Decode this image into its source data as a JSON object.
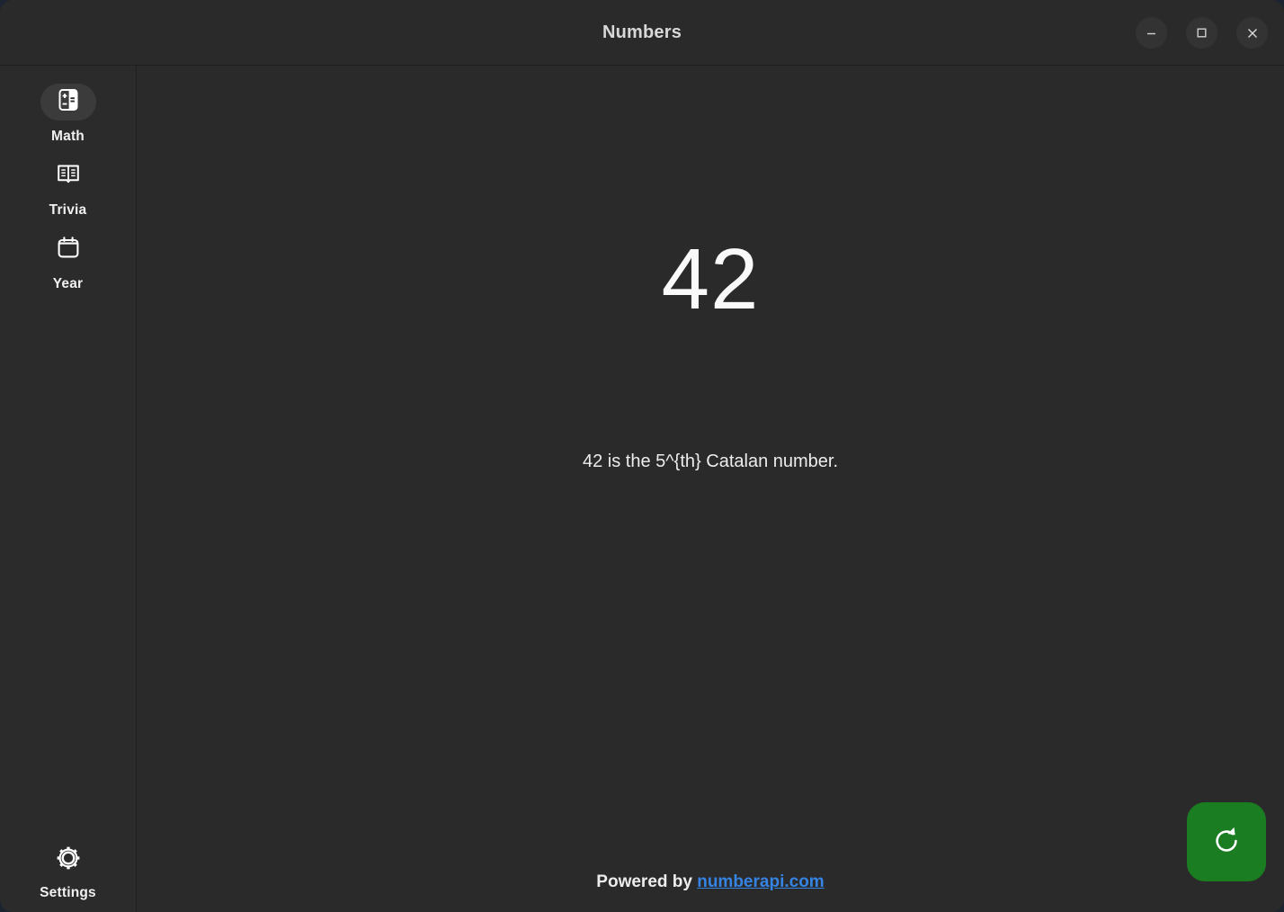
{
  "window": {
    "title": "Numbers",
    "controls": [
      {
        "name": "minimize",
        "icon": "minimize-icon"
      },
      {
        "name": "maximize",
        "icon": "maximize-icon"
      },
      {
        "name": "close",
        "icon": "close-icon"
      }
    ]
  },
  "sidebar": {
    "items": [
      {
        "label": "Math",
        "icon": "calculator-icon",
        "selected": true
      },
      {
        "label": "Trivia",
        "icon": "open-book-icon",
        "selected": false
      },
      {
        "label": "Year",
        "icon": "calendar-icon",
        "selected": false
      }
    ],
    "settings": {
      "label": "Settings",
      "icon": "gear-icon"
    }
  },
  "main": {
    "number": "42",
    "fact": "42 is the 5^{th} Catalan number."
  },
  "footer": {
    "prefix": "Powered by ",
    "link_text": "numberapi.com"
  },
  "actions": {
    "refresh": {
      "icon": "refresh-icon",
      "label": ""
    }
  },
  "colors": {
    "window_bg": "#2a2a2a",
    "sidebar_bg": "#2b2b2b",
    "selected_pill": "#3b3b3b",
    "accent_link": "#3584e4",
    "refresh_green": "#1a7d21",
    "text_primary": "#ededed",
    "desktop_bg": "#1b2430"
  }
}
